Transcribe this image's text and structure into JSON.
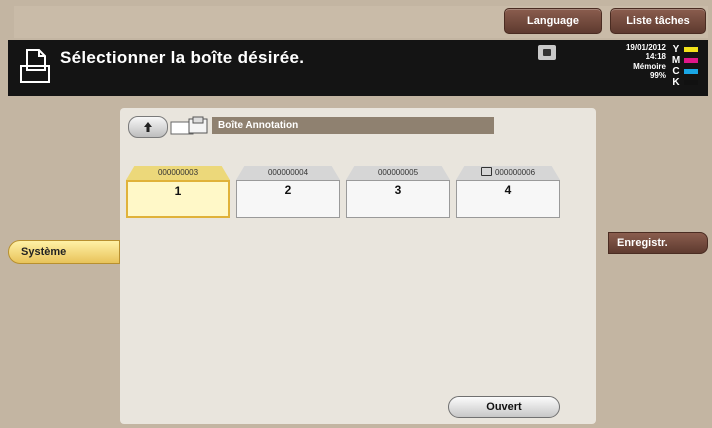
{
  "top_buttons": {
    "language": "Language",
    "task_list": "Liste tâches"
  },
  "header": {
    "title": "Sélectionner la boîte désirée.",
    "date": "19/01/2012",
    "time": "14:18",
    "memory_label": "Mémoire",
    "memory_value": "99%",
    "toner": [
      {
        "letter": "Y",
        "color": "#f2e21a"
      },
      {
        "letter": "M",
        "color": "#e0168a"
      },
      {
        "letter": "C",
        "color": "#1aa7e6"
      },
      {
        "letter": "K",
        "color": "#111111"
      }
    ]
  },
  "path": {
    "label": "Boîte Annotation"
  },
  "boxes": [
    {
      "number": "000000003",
      "index": "1",
      "selected": true,
      "locked": false
    },
    {
      "number": "000000004",
      "index": "2",
      "selected": false,
      "locked": false
    },
    {
      "number": "000000005",
      "index": "3",
      "selected": false,
      "locked": false
    },
    {
      "number": "000000006",
      "index": "4",
      "selected": false,
      "locked": true
    }
  ],
  "side": {
    "left_tab": "Système",
    "right_button": "Enregistr."
  },
  "actions": {
    "open": "Ouvert"
  }
}
